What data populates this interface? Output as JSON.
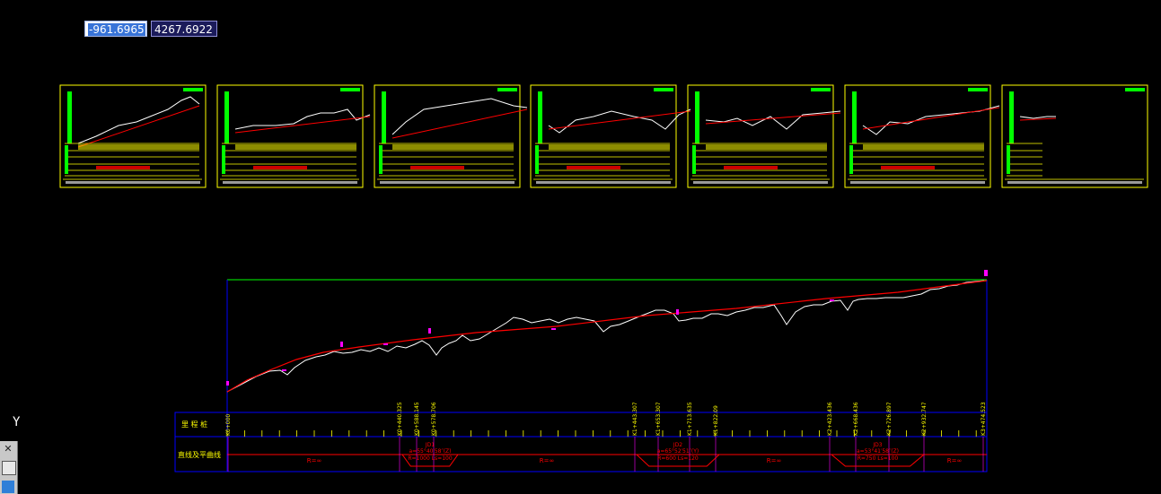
{
  "coordinates": {
    "x_value": "-961.6965",
    "y_value": "4267.6922"
  },
  "ucs_icon": {
    "axis_label": "Y"
  },
  "palette": {
    "close_glyph": "✕"
  },
  "profile_table": {
    "row_label_1": "里 程 桩",
    "row_label_2": "直线及平曲线",
    "station_labels": [
      "K0+000",
      "K0+440.325",
      "K0+588.145",
      "K0+578.706",
      "K1+443.307",
      "K1+653.307",
      "K1+713.635",
      "K1+822.09",
      "K2+423.436",
      "K2+668.436",
      "K2+726.897",
      "K2+932.747",
      "K3+474.523"
    ],
    "curve_blocks": [
      {
        "name": "JD1",
        "spec": "a=55°40′58″(Z)",
        "params": "R=1000  Ls=100"
      },
      {
        "name": "JD2",
        "spec": "a=65°52′51″(Y)",
        "params": "R=600  Ls=120"
      },
      {
        "name": "JD3",
        "spec": "a=53°41′58″(Z)",
        "params": "R=750  Ls=100"
      }
    ],
    "straight_label": "R=∞"
  },
  "colors": {
    "background": "#000000",
    "sheet_frame": "#ffff00",
    "ground_line": "#ffffff",
    "design_line": "#ff0000",
    "marker": "#ff00ff",
    "table_frame": "#0000ff",
    "top_line": "#00ff00",
    "chart_fill": "#00ff00"
  },
  "sheet_count": 7
}
